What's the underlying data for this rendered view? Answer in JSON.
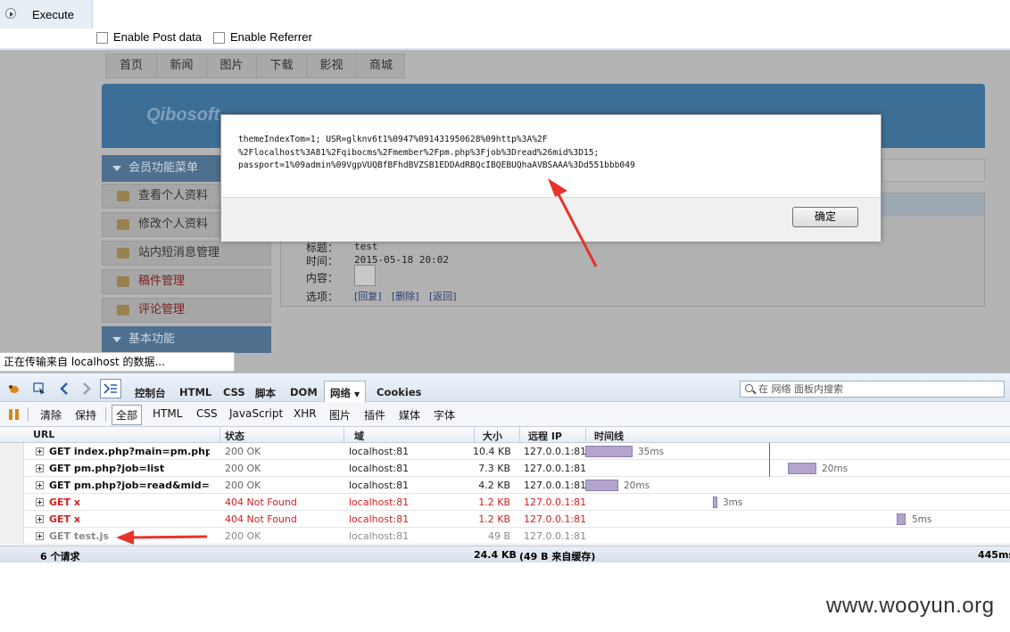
{
  "hackbar": {
    "execute_label": "Execute",
    "enable_post_label": "Enable Post data",
    "enable_referrer_label": "Enable Referrer"
  },
  "site": {
    "nav": [
      "首页",
      "新闻",
      "图片",
      "下载",
      "影视",
      "商城"
    ],
    "logo_text": "Qibosoft",
    "member_menu_title": "会员功能菜单",
    "member_menu_items": [
      "查看个人资料",
      "修改个人资料",
      "站内短消息管理",
      "稿件管理",
      "评论管理"
    ],
    "basic_menu_title": "基本功能",
    "message": {
      "title_label": "标题：",
      "title_value": "test",
      "time_label": "时间：",
      "time_value": "2015-05-18 20:02",
      "content_label": "内容：",
      "options_label": "选项：",
      "reply": "[回复]",
      "delete": "[删除]",
      "back": "[返回]"
    }
  },
  "alert": {
    "message": "themeIndexTom=1; USR=glknv6t1%0947%091431950628%09http%3A%2F\n%2Flocalhost%3A81%2Fqibocms%2Fmember%2Fpm.php%3Fjob%3Dread%26mid%3D15;\npassport=1%09admin%09VgpVUQBfBFhdBVZSB1EDDAdRBQcIBQEBUQhaAVBSAAA%3Dd551bbb049",
    "ok_label": "确定"
  },
  "statusbar": {
    "text": "正在传输来自 localhost 的数据..."
  },
  "firebug": {
    "tabs": [
      "控制台",
      "HTML",
      "CSS",
      "脚本",
      "DOM",
      "网络",
      "Cookies"
    ],
    "active_tab": "网络",
    "search_placeholder": "在 网络 面板内搜索",
    "filters": [
      "清除",
      "保持",
      "全部",
      "HTML",
      "CSS",
      "JavaScript",
      "XHR",
      "图片",
      "插件",
      "媒体",
      "字体"
    ],
    "active_filter": "全部",
    "columns": [
      "URL",
      "状态",
      "域",
      "大小",
      "远程 IP",
      "时间线"
    ],
    "requests": [
      {
        "url": "GET index.php?main=pm.php?jc",
        "status": "200 OK",
        "domain": "localhost:81",
        "size": "10.4 KB",
        "ip": "127.0.0.1:81",
        "time": "35ms",
        "kind": "ok"
      },
      {
        "url": "GET pm.php?job=list",
        "status": "200 OK",
        "domain": "localhost:81",
        "size": "7.3 KB",
        "ip": "127.0.0.1:81",
        "time": "20ms",
        "kind": "ok"
      },
      {
        "url": "GET pm.php?job=read&mid=15",
        "status": "200 OK",
        "domain": "localhost:81",
        "size": "4.2 KB",
        "ip": "127.0.0.1:81",
        "time": "20ms",
        "kind": "ok"
      },
      {
        "url": "GET x",
        "status": "404 Not Found",
        "domain": "localhost:81",
        "size": "1.2 KB",
        "ip": "127.0.0.1:81",
        "time": "3ms",
        "kind": "err"
      },
      {
        "url": "GET x",
        "status": "404 Not Found",
        "domain": "localhost:81",
        "size": "1.2 KB",
        "ip": "127.0.0.1:81",
        "time": "5ms",
        "kind": "err"
      },
      {
        "url": "GET test.js",
        "status": "200 OK",
        "domain": "localhost:81",
        "size": "49 B",
        "ip": "127.0.0.1:81",
        "time": "",
        "kind": "grey"
      }
    ],
    "summary": {
      "count": "6 个请求",
      "total": "24.4 KB",
      "cache": "(49 B 来自缓存)",
      "duration": "445ms"
    }
  },
  "watermark": "www.wooyun.org",
  "colors": {
    "error_red": "#d12020",
    "arrow_red": "#e8322a",
    "timeline_bar": "#b3a4cc"
  }
}
